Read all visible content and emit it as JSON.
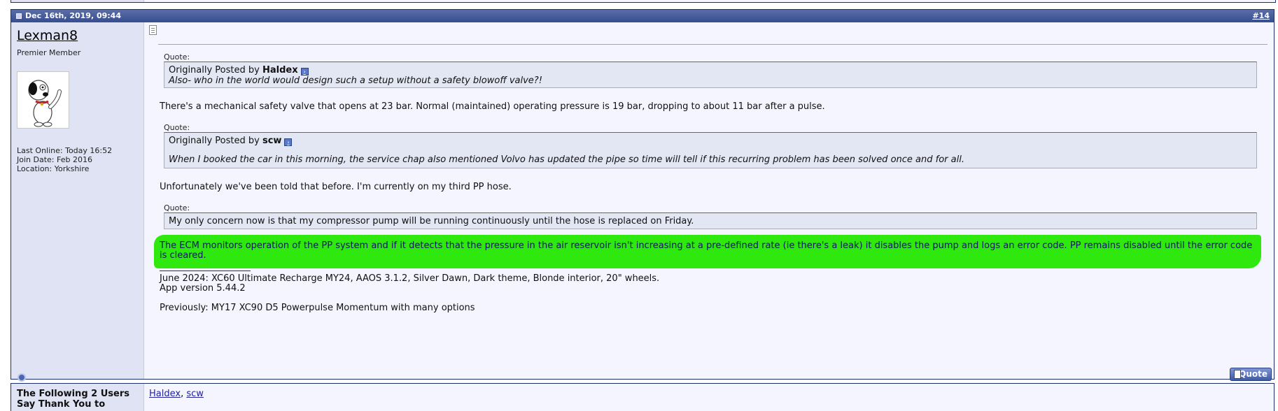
{
  "post": {
    "date": "Dec 16th, 2019, 09:44",
    "number": "#14",
    "user": {
      "name": "Lexman8",
      "title": "Premier Member",
      "last_online": "Last Online: Today 16:52",
      "join_date": "Join Date: Feb 2016",
      "location": "Location: Yorkshire"
    },
    "quote_label": "Quote:",
    "quotes": [
      {
        "prefix": "Originally Posted by",
        "author": "Haldex",
        "text": "Also- who in the world would design such a setup without a safety blowoff valve?!"
      },
      {
        "prefix": "Originally Posted by",
        "author": "scw",
        "text": "When I booked the car in this morning, the service chap also mentioned Volvo has updated the pipe so time will tell if this recurring problem has been solved once and for all."
      },
      {
        "text": "My only concern now is that my compressor pump will be running continuously until the hose is replaced on Friday."
      }
    ],
    "paragraphs": [
      "There's a mechanical safety valve that opens at 23 bar. Normal (maintained) operating pressure is 19 bar, dropping to about 11 bar after a pulse.",
      "Unfortunately we've been told that before. I'm currently on my third PP hose.",
      "The ECM monitors operation of the PP system and if it detects that the pressure in the air reservoir isn't increasing at a pre-defined rate (ie there's a leak) it disables the pump and logs an error code. PP remains disabled until the error code is cleared."
    ],
    "signature": {
      "line1": "June 2024: XC60 Ultimate Recharge MY24, AAOS 3.1.2, Silver Dawn, Dark theme, Blonde interior, 20\" wheels.",
      "line2": "App version 5.44.2",
      "line3": "Previously: MY17 XC90 D5 Powerpulse Momentum with many options"
    },
    "quote_button": "Quote",
    "highlight_color": "#2ee80e"
  },
  "thanks": {
    "title_line1": "The Following 2 Users",
    "title_line2": "Say Thank You to",
    "users": [
      "Haldex",
      "scw"
    ],
    "separator": ", "
  }
}
